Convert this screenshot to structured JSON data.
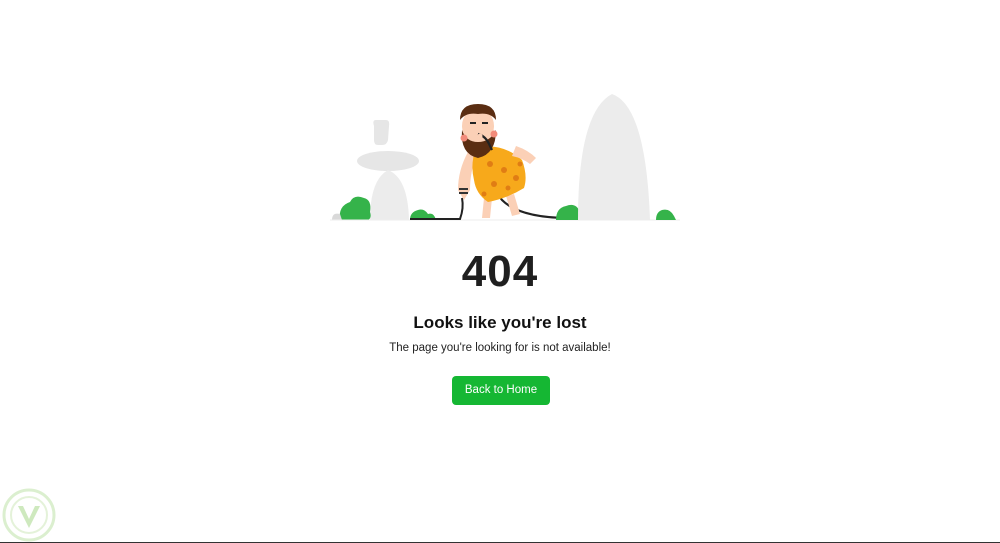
{
  "error": {
    "code": "404",
    "title": "Looks like you're lost",
    "message": "The page you're looking for is not available!"
  },
  "actions": {
    "home_label": "Back to Home"
  },
  "icons": {
    "illustration": "caveman-with-cable-illustration",
    "watermark": "watermark-logo-icon"
  },
  "colors": {
    "accent": "#15b733",
    "text": "#1f1f1f",
    "rock": "#ececec",
    "bush": "#35b34a",
    "skin": "#fbd0b6",
    "fur": "#f7a91b"
  }
}
